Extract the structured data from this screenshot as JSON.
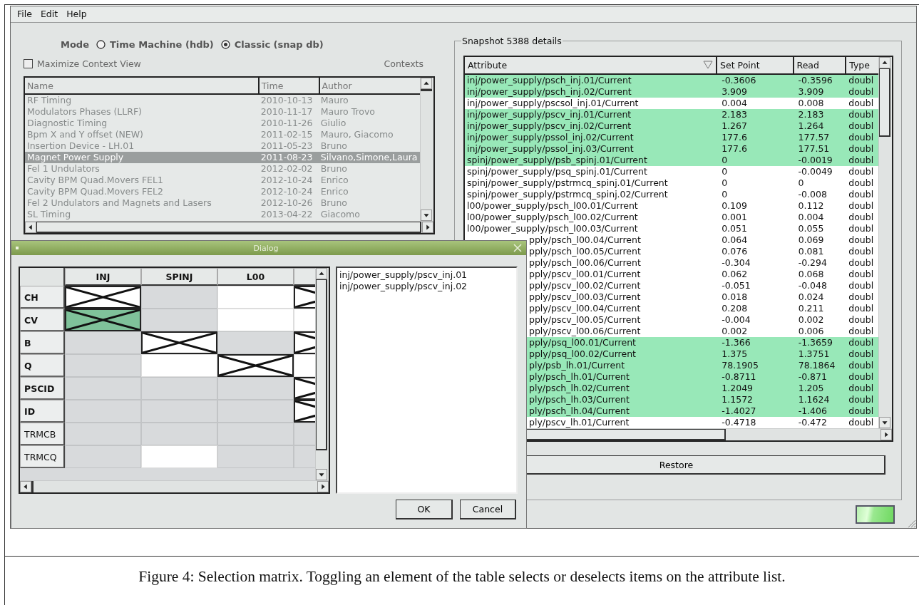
{
  "menu": [
    "File",
    "Edit",
    "Help"
  ],
  "mode": {
    "label": "Mode",
    "options": [
      {
        "label": "Time Machine (hdb)",
        "selected": false
      },
      {
        "label": "Classic (snap db)",
        "selected": true
      }
    ]
  },
  "maximize": {
    "label": "Maximize Context View",
    "checked": false
  },
  "contexts": {
    "title": "Contexts",
    "disabled": true,
    "columns": [
      "Name",
      "Time",
      "Author"
    ],
    "rows": [
      {
        "name": "RF Timing",
        "time": "2010-10-13",
        "author": "Mauro",
        "selected": false
      },
      {
        "name": "Modulators Phases (LLRF)",
        "time": "2010-11-17",
        "author": "Mauro Trovo",
        "selected": false
      },
      {
        "name": "Diagnostic Timing",
        "time": "2010-11-26",
        "author": "Giulio",
        "selected": false
      },
      {
        "name": "Bpm X and Y offset (NEW)",
        "time": "2011-02-15",
        "author": "Mauro, Giacomo",
        "selected": false
      },
      {
        "name": "Insertion Device - LH.01",
        "time": "2011-05-23",
        "author": "Bruno",
        "selected": false
      },
      {
        "name": "Magnet Power Supply",
        "time": "2011-08-23",
        "author": "Silvano,Simone,Laura",
        "selected": true
      },
      {
        "name": "Fel 1 Undulators",
        "time": "2012-02-02",
        "author": "Bruno",
        "selected": false
      },
      {
        "name": "Cavity BPM Quad.Movers FEL1",
        "time": "2012-10-24",
        "author": "Enrico",
        "selected": false
      },
      {
        "name": "Cavity BPM Quad.Movers FEL2",
        "time": "2012-10-24",
        "author": "Enrico",
        "selected": false
      },
      {
        "name": "Fel 2 Undulators and Magnets and Lasers",
        "time": "2012-10-26",
        "author": "Bruno",
        "selected": false
      },
      {
        "name": "SL Timing",
        "time": "2013-04-22",
        "author": "Giacomo",
        "selected": false
      }
    ]
  },
  "snapshot": {
    "title": "Snapshot 5388 details",
    "columns": [
      "Attribute",
      "Set Point",
      "Read",
      "Type"
    ],
    "rows": [
      {
        "kind": "full",
        "attribute": "inj/power_supply/psch_inj.01/Current",
        "set_point": "-0.3606",
        "read": "-0.3596",
        "type": "doubl",
        "highlighted": true
      },
      {
        "kind": "full",
        "attribute": "inj/power_supply/psch_inj.02/Current",
        "set_point": "3.909",
        "read": "3.909",
        "type": "doubl",
        "highlighted": true
      },
      {
        "kind": "full",
        "attribute": "inj/power_supply/pscsol_inj.01/Current",
        "set_point": "0.004",
        "read": "0.008",
        "type": "doubl",
        "highlighted": false
      },
      {
        "kind": "full",
        "attribute": "inj/power_supply/pscv_inj.01/Current",
        "set_point": "2.183",
        "read": "2.183",
        "type": "doubl",
        "highlighted": true
      },
      {
        "kind": "full",
        "attribute": "inj/power_supply/pscv_inj.02/Current",
        "set_point": "1.267",
        "read": "1.264",
        "type": "doubl",
        "highlighted": true
      },
      {
        "kind": "full",
        "attribute": "inj/power_supply/pssol_inj.02/Current",
        "set_point": "177.6",
        "read": "177.57",
        "type": "doubl",
        "highlighted": true
      },
      {
        "kind": "full",
        "attribute": "inj/power_supply/pssol_inj.03/Current",
        "set_point": "177.6",
        "read": "177.51",
        "type": "doubl",
        "highlighted": true
      },
      {
        "kind": "full",
        "attribute": "spinj/power_supply/psb_spinj.01/Current",
        "set_point": "0",
        "read": "-0.0019",
        "type": "doubl",
        "highlighted": true
      },
      {
        "kind": "full",
        "attribute": "spinj/power_supply/psq_spinj.01/Current",
        "set_point": "0",
        "read": "-0.0049",
        "type": "doubl",
        "highlighted": false
      },
      {
        "kind": "full",
        "attribute": "spinj/power_supply/pstrmcq_spinj.01/Current",
        "set_point": "0",
        "read": "0",
        "type": "doubl",
        "highlighted": false
      },
      {
        "kind": "full",
        "attribute": "spinj/power_supply/pstrmcq_spinj.02/Current",
        "set_point": "0",
        "read": "-0.008",
        "type": "doubl",
        "highlighted": false
      },
      {
        "kind": "full",
        "attribute": "l00/power_supply/psch_l00.01/Current",
        "set_point": "0.109",
        "read": "0.112",
        "type": "doubl",
        "highlighted": false
      },
      {
        "kind": "full",
        "attribute": "l00/power_supply/psch_l00.02/Current",
        "set_point": "0.001",
        "read": "0.004",
        "type": "doubl",
        "highlighted": false
      },
      {
        "kind": "full",
        "attribute": "l00/power_supply/psch_l00.03/Current",
        "set_point": "0.051",
        "read": "0.055",
        "type": "doubl",
        "highlighted": false
      },
      {
        "kind": "partial",
        "attribute": "pply/psch_l00.04/Current",
        "set_point": "0.064",
        "read": "0.069",
        "type": "doubl",
        "highlighted": false
      },
      {
        "kind": "partial",
        "attribute": "pply/psch_l00.05/Current",
        "set_point": "0.076",
        "read": "0.081",
        "type": "doubl",
        "highlighted": false
      },
      {
        "kind": "partial",
        "attribute": "pply/psch_l00.06/Current",
        "set_point": "-0.304",
        "read": "-0.294",
        "type": "doubl",
        "highlighted": false
      },
      {
        "kind": "partial",
        "attribute": "pply/pscv_l00.01/Current",
        "set_point": "0.062",
        "read": "0.068",
        "type": "doubl",
        "highlighted": false
      },
      {
        "kind": "partial",
        "attribute": "pply/pscv_l00.02/Current",
        "set_point": "-0.051",
        "read": "-0.048",
        "type": "doubl",
        "highlighted": false
      },
      {
        "kind": "partial",
        "attribute": "pply/pscv_l00.03/Current",
        "set_point": "0.018",
        "read": "0.024",
        "type": "doubl",
        "highlighted": false
      },
      {
        "kind": "partial",
        "attribute": "pply/pscv_l00.04/Current",
        "set_point": "0.208",
        "read": "0.211",
        "type": "doubl",
        "highlighted": false
      },
      {
        "kind": "partial",
        "attribute": "pply/pscv_l00.05/Current",
        "set_point": "-0.004",
        "read": "0.002",
        "type": "doubl",
        "highlighted": false
      },
      {
        "kind": "partial",
        "attribute": "pply/pscv_l00.06/Current",
        "set_point": "0.002",
        "read": "0.006",
        "type": "doubl",
        "highlighted": false
      },
      {
        "kind": "partial",
        "attribute": "pply/psq_l00.01/Current",
        "set_point": "-1.366",
        "read": "-1.3659",
        "type": "doubl",
        "highlighted": true
      },
      {
        "kind": "partial",
        "attribute": "pply/psq_l00.02/Current",
        "set_point": "1.375",
        "read": "1.3751",
        "type": "doubl",
        "highlighted": true
      },
      {
        "kind": "partial",
        "attribute": "ply/psb_lh.01/Current",
        "set_point": "78.1905",
        "read": "78.1864",
        "type": "doubl",
        "highlighted": true
      },
      {
        "kind": "partial",
        "attribute": "ply/psch_lh.01/Current",
        "set_point": "-0.8711",
        "read": "-0.871",
        "type": "doubl",
        "highlighted": true
      },
      {
        "kind": "partial",
        "attribute": "ply/psch_lh.02/Current",
        "set_point": "1.2049",
        "read": "1.205",
        "type": "doubl",
        "highlighted": true
      },
      {
        "kind": "partial",
        "attribute": "ply/psch_lh.03/Current",
        "set_point": "1.1572",
        "read": "1.1624",
        "type": "doubl",
        "highlighted": true
      },
      {
        "kind": "partial",
        "attribute": "ply/psch_lh.04/Current",
        "set_point": "-1.4027",
        "read": "-1.406",
        "type": "doubl",
        "highlighted": true
      },
      {
        "kind": "partial",
        "attribute": "ply/pscv_lh.01/Current",
        "set_point": "-0.4718",
        "read": "-0.472",
        "type": "doubl",
        "highlighted": false
      }
    ],
    "restore": "Restore"
  },
  "dialog": {
    "title": "Dialog",
    "matrix": {
      "columns": [
        "INJ",
        "SPINJ",
        "L00"
      ],
      "rows": [
        {
          "label": "CH",
          "populated": true,
          "cells": [
            {
              "kind": "cross"
            },
            {
              "kind": "none"
            },
            {
              "kind": "free"
            },
            {
              "kind": "cross"
            }
          ]
        },
        {
          "label": "CV",
          "populated": true,
          "cells": [
            {
              "kind": "cross_selected"
            },
            {
              "kind": "none"
            },
            {
              "kind": "free"
            },
            {
              "kind": "free"
            }
          ]
        },
        {
          "label": "B",
          "populated": true,
          "cells": [
            {
              "kind": "none"
            },
            {
              "kind": "cross"
            },
            {
              "kind": "none"
            },
            {
              "kind": "cross"
            }
          ]
        },
        {
          "label": "Q",
          "populated": true,
          "cells": [
            {
              "kind": "none"
            },
            {
              "kind": "free"
            },
            {
              "kind": "cross"
            },
            {
              "kind": "free"
            }
          ]
        },
        {
          "label": "PSCID",
          "populated": true,
          "cells": [
            {
              "kind": "none"
            },
            {
              "kind": "none"
            },
            {
              "kind": "none"
            },
            {
              "kind": "cross"
            }
          ]
        },
        {
          "label": "ID",
          "populated": true,
          "cells": [
            {
              "kind": "none"
            },
            {
              "kind": "none"
            },
            {
              "kind": "none"
            },
            {
              "kind": "cross"
            }
          ]
        },
        {
          "label": "TRMCB",
          "populated": false,
          "cells": [
            {
              "kind": "none"
            },
            {
              "kind": "none"
            },
            {
              "kind": "none"
            },
            {
              "kind": "none"
            }
          ]
        },
        {
          "label": "TRMCQ",
          "populated": false,
          "cells": [
            {
              "kind": "none"
            },
            {
              "kind": "free"
            },
            {
              "kind": "none"
            },
            {
              "kind": "none"
            }
          ]
        }
      ]
    },
    "items": [
      "inj/power_supply/pscv_inj.01",
      "inj/power_supply/pscv_inj.02"
    ],
    "buttons": [
      "OK",
      "Cancel"
    ]
  },
  "caption": "Figure 4: Selection matrix. Toggling an element of the table selects or deselects items on the attribute list."
}
